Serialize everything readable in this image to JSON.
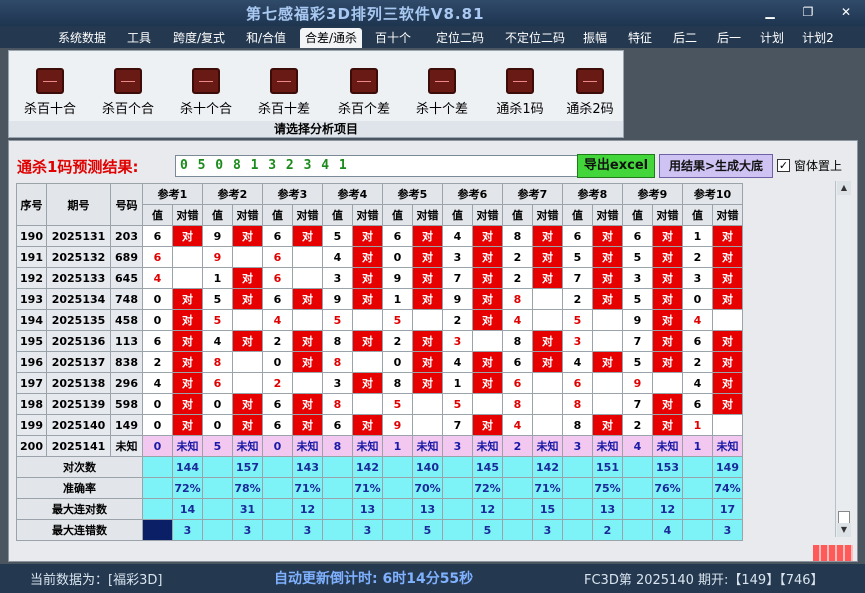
{
  "window": {
    "title": "第七感福彩3D排列三软件V8.81",
    "min_icon": "minimize-icon",
    "max_icon": "restore-icon",
    "close_icon": "close-icon"
  },
  "menu": [
    "系统数据",
    "工具",
    "跨度/复式",
    "和/合值",
    "合差/通杀",
    "百十个",
    "定位二码",
    "不定位二码",
    "振幅",
    "特征",
    "后二",
    "后一",
    "计划",
    "计划2"
  ],
  "menu_active": "合差/通杀",
  "ribbon": {
    "buttons": [
      "杀百十合",
      "杀百个合",
      "杀十个合",
      "杀百十差",
      "杀百个差",
      "杀十个差",
      "通杀1码",
      "通杀2码"
    ],
    "caption": "请选择分析项目"
  },
  "prediction": {
    "label": "通杀1码预测结果:",
    "value": "0 5 0 8 1 3 2 3 4 1"
  },
  "export_label": "导出excel",
  "generate_label": "用结果>生成大底",
  "ontop": {
    "checked": true,
    "label": "窗体置上"
  },
  "table": {
    "head_main": [
      "序号",
      "期号",
      "号码"
    ],
    "refs": [
      "参考1",
      "参考2",
      "参考3",
      "参考4",
      "参考5",
      "参考6",
      "参考7",
      "参考8",
      "参考9",
      "参考10"
    ],
    "sub_value": "值",
    "sub_result": "对错",
    "rows": [
      {
        "seq": "190",
        "issue": "2025131",
        "num": "203",
        "refs": [
          [
            "6",
            "对"
          ],
          [
            "9",
            "对"
          ],
          [
            "6",
            "对"
          ],
          [
            "5",
            "对"
          ],
          [
            "6",
            "对"
          ],
          [
            "4",
            "对"
          ],
          [
            "8",
            "对"
          ],
          [
            "6",
            "对"
          ],
          [
            "6",
            "对"
          ],
          [
            "1",
            "对"
          ]
        ]
      },
      {
        "seq": "191",
        "issue": "2025132",
        "num": "689",
        "refs": [
          [
            "6",
            ""
          ],
          [
            "9",
            ""
          ],
          [
            "6",
            ""
          ],
          [
            "4",
            "对"
          ],
          [
            "0",
            "对"
          ],
          [
            "3",
            "对"
          ],
          [
            "2",
            "对"
          ],
          [
            "5",
            "对"
          ],
          [
            "5",
            "对"
          ],
          [
            "2",
            "对"
          ]
        ]
      },
      {
        "seq": "192",
        "issue": "2025133",
        "num": "645",
        "refs": [
          [
            "4",
            ""
          ],
          [
            "1",
            "对"
          ],
          [
            "6",
            ""
          ],
          [
            "3",
            "对"
          ],
          [
            "9",
            "对"
          ],
          [
            "7",
            "对"
          ],
          [
            "2",
            "对"
          ],
          [
            "7",
            "对"
          ],
          [
            "3",
            "对"
          ],
          [
            "3",
            "对"
          ]
        ]
      },
      {
        "seq": "193",
        "issue": "2025134",
        "num": "748",
        "refs": [
          [
            "0",
            "对"
          ],
          [
            "5",
            "对"
          ],
          [
            "6",
            "对"
          ],
          [
            "9",
            "对"
          ],
          [
            "1",
            "对"
          ],
          [
            "9",
            "对"
          ],
          [
            "8",
            ""
          ],
          [
            "2",
            "对"
          ],
          [
            "5",
            "对"
          ],
          [
            "0",
            "对"
          ]
        ]
      },
      {
        "seq": "194",
        "issue": "2025135",
        "num": "458",
        "refs": [
          [
            "0",
            "对"
          ],
          [
            "5",
            ""
          ],
          [
            "4",
            ""
          ],
          [
            "5",
            ""
          ],
          [
            "5",
            ""
          ],
          [
            "2",
            "对"
          ],
          [
            "4",
            ""
          ],
          [
            "5",
            ""
          ],
          [
            "9",
            "对"
          ],
          [
            "4",
            ""
          ]
        ]
      },
      {
        "seq": "195",
        "issue": "2025136",
        "num": "113",
        "refs": [
          [
            "6",
            "对"
          ],
          [
            "4",
            "对"
          ],
          [
            "2",
            "对"
          ],
          [
            "8",
            "对"
          ],
          [
            "2",
            "对"
          ],
          [
            "3",
            ""
          ],
          [
            "8",
            "对"
          ],
          [
            "3",
            ""
          ],
          [
            "7",
            "对"
          ],
          [
            "6",
            "对"
          ]
        ]
      },
      {
        "seq": "196",
        "issue": "2025137",
        "num": "838",
        "refs": [
          [
            "2",
            "对"
          ],
          [
            "8",
            ""
          ],
          [
            "0",
            "对"
          ],
          [
            "8",
            ""
          ],
          [
            "0",
            "对"
          ],
          [
            "4",
            "对"
          ],
          [
            "6",
            "对"
          ],
          [
            "4",
            "对"
          ],
          [
            "5",
            "对"
          ],
          [
            "2",
            "对"
          ]
        ]
      },
      {
        "seq": "197",
        "issue": "2025138",
        "num": "296",
        "refs": [
          [
            "4",
            "对"
          ],
          [
            "6",
            ""
          ],
          [
            "2",
            ""
          ],
          [
            "3",
            "对"
          ],
          [
            "8",
            "对"
          ],
          [
            "1",
            "对"
          ],
          [
            "6",
            ""
          ],
          [
            "6",
            ""
          ],
          [
            "9",
            ""
          ],
          [
            "4",
            "对"
          ]
        ]
      },
      {
        "seq": "198",
        "issue": "2025139",
        "num": "598",
        "refs": [
          [
            "0",
            "对"
          ],
          [
            "0",
            "对"
          ],
          [
            "6",
            "对"
          ],
          [
            "8",
            ""
          ],
          [
            "5",
            ""
          ],
          [
            "5",
            ""
          ],
          [
            "8",
            ""
          ],
          [
            "8",
            ""
          ],
          [
            "7",
            "对"
          ],
          [
            "6",
            "对"
          ]
        ]
      },
      {
        "seq": "199",
        "issue": "2025140",
        "num": "149",
        "refs": [
          [
            "0",
            "对"
          ],
          [
            "0",
            "对"
          ],
          [
            "6",
            "对"
          ],
          [
            "6",
            "对"
          ],
          [
            "9",
            ""
          ],
          [
            "7",
            "对"
          ],
          [
            "4",
            ""
          ],
          [
            "8",
            "对"
          ],
          [
            "2",
            "对"
          ],
          [
            "1",
            ""
          ]
        ]
      }
    ],
    "unknown_row": {
      "seq": "200",
      "issue": "2025141",
      "num": "未知",
      "refs": [
        [
          "0",
          "未知"
        ],
        [
          "5",
          "未知"
        ],
        [
          "0",
          "未知"
        ],
        [
          "8",
          "未知"
        ],
        [
          "1",
          "未知"
        ],
        [
          "3",
          "未知"
        ],
        [
          "2",
          "未知"
        ],
        [
          "3",
          "未知"
        ],
        [
          "4",
          "未知"
        ],
        [
          "1",
          "未知"
        ]
      ]
    },
    "stats": [
      {
        "label": "对次数",
        "values": [
          "144",
          "157",
          "143",
          "142",
          "140",
          "145",
          "142",
          "151",
          "153",
          "149"
        ]
      },
      {
        "label": "准确率",
        "values": [
          "72%",
          "78%",
          "71%",
          "71%",
          "70%",
          "72%",
          "71%",
          "75%",
          "76%",
          "74%"
        ]
      },
      {
        "label": "最大连对数",
        "values": [
          "14",
          "31",
          "12",
          "13",
          "13",
          "12",
          "15",
          "13",
          "12",
          "17"
        ]
      },
      {
        "label": "最大连错数",
        "values": [
          "3",
          "3",
          "3",
          "3",
          "5",
          "5",
          "3",
          "2",
          "4",
          "3"
        ]
      }
    ]
  },
  "status": {
    "data_source": "当前数据为：[福彩3D]",
    "countdown": "自动更新倒计时:  6时14分55秒",
    "issue_info": "FC3D第 2025140 期开:【149】【746】"
  }
}
